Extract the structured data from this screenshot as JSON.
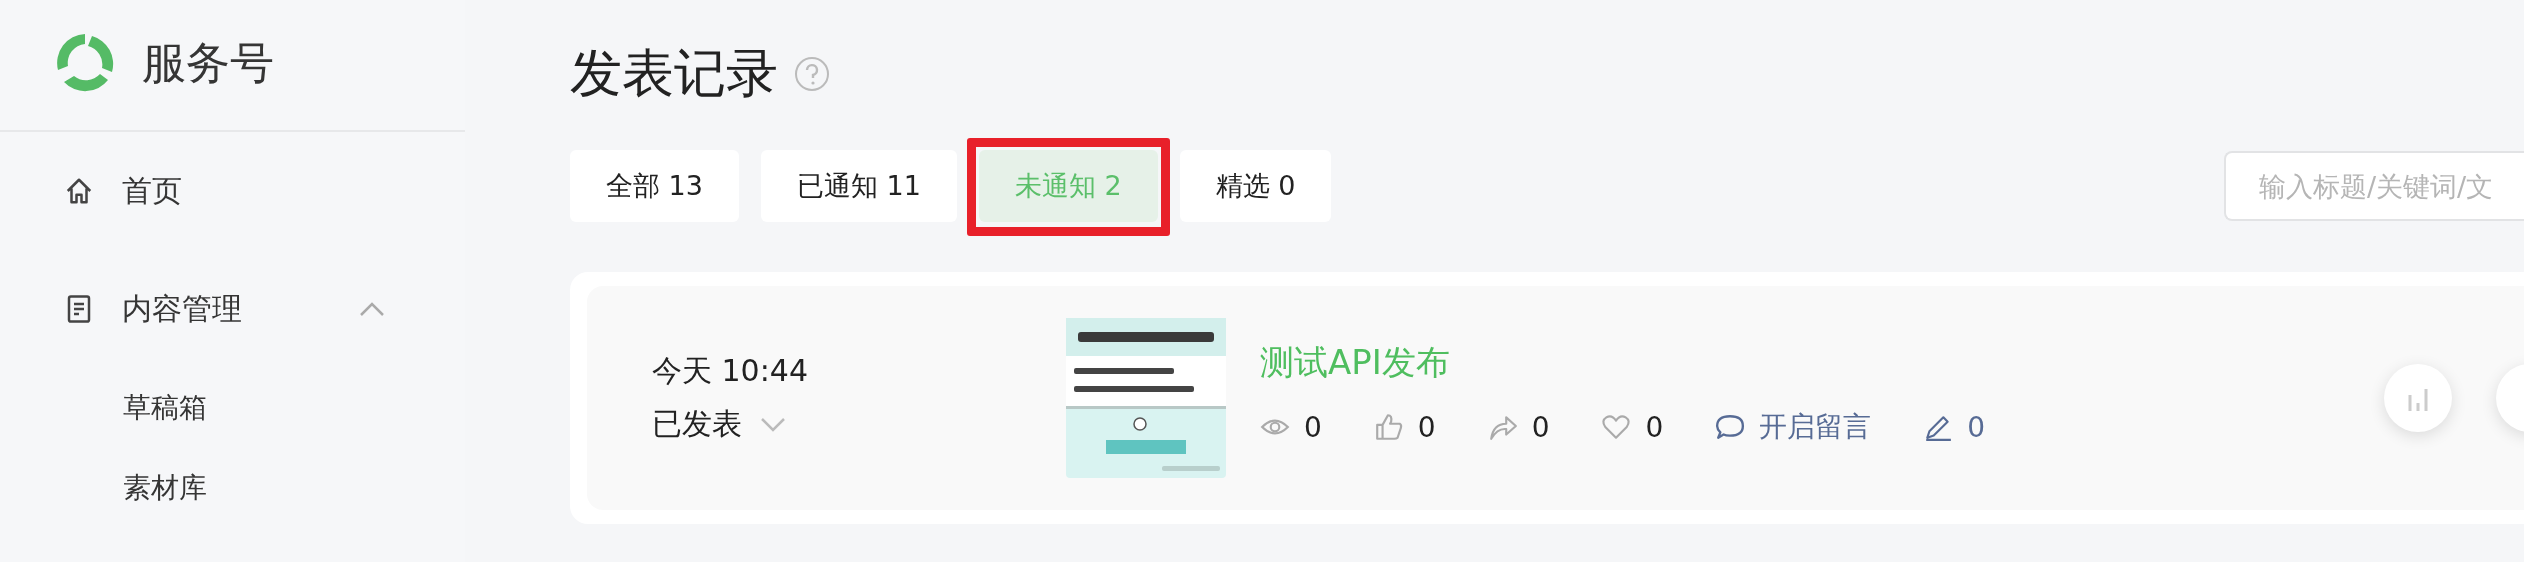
{
  "sidebar": {
    "brand": "服务号",
    "items": [
      {
        "label": "首页",
        "kind": "page"
      },
      {
        "label": "内容管理",
        "kind": "section",
        "expanded": true,
        "children": [
          {
            "label": "草稿箱"
          },
          {
            "label": "素材库"
          }
        ]
      }
    ]
  },
  "page": {
    "title": "发表记录"
  },
  "tabs": [
    {
      "label": "全部 13",
      "selected": false,
      "highlighted": false
    },
    {
      "label": "已通知 11",
      "selected": false,
      "highlighted": false
    },
    {
      "label": "未通知 2",
      "selected": true,
      "highlighted": true
    },
    {
      "label": "精选 0",
      "selected": false,
      "highlighted": false
    }
  ],
  "search": {
    "placeholder": "输入标题/关键词/文"
  },
  "posts": [
    {
      "time": "今天 10:44",
      "status": "已发表",
      "title": "测试API发布",
      "stats": [
        {
          "kind": "views",
          "text": "0"
        },
        {
          "kind": "likes",
          "text": "0"
        },
        {
          "kind": "shares",
          "text": "0"
        },
        {
          "kind": "favorites",
          "text": "0"
        },
        {
          "kind": "comments",
          "text": "开启留言"
        },
        {
          "kind": "edits",
          "text": "0"
        }
      ]
    }
  ]
}
